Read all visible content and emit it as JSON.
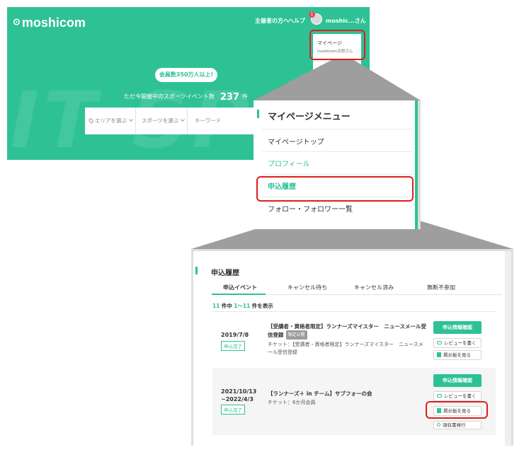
{
  "header": {
    "logo_mark": "⊙",
    "logo_text": "moshicom",
    "nav_organizer": "主催者の方へ",
    "nav_help": "ヘルプ",
    "avatar_badge": "1",
    "user_name": "moshic...さん"
  },
  "dropdown": {
    "title": "マイページ",
    "subtitle": "moshicom太郎さん"
  },
  "hero": {
    "watermark": "IT SPO",
    "members_pill": "会員数350万人以上!",
    "count_label": "ただ今開催中のスポーツイベント数",
    "count_value": "237",
    "count_unit": "件"
  },
  "search": {
    "area": "エリアを選ぶ",
    "sport": "スポーツを選ぶ",
    "keyword": "キーワード"
  },
  "menu": {
    "title": "マイページメニュー",
    "items": [
      "マイページトップ",
      "プロフィール",
      "申込履歴",
      "フォロー・フォロワー一覧"
    ]
  },
  "history": {
    "title": "申込履歴",
    "tabs": [
      "申込イベント",
      "キャンセル待ち",
      "キャンセル済み",
      "無断不参加"
    ],
    "count": {
      "total": "11",
      "mid1": "件中",
      "range": "1〜11",
      "mid2": "件を表示"
    },
    "rows": [
      {
        "date": "2019/7/8",
        "status": "申込完了",
        "title": "【受講者・資格者限定】ランナーズマイスター　ニュースメール受信登録",
        "badge": "限定公開",
        "ticket_label": "チケット：",
        "ticket": "【受講者・資格者限定】ランナーズマイスター　ニュースメール受信登録",
        "confirm": "申込情報確認",
        "review": "レビューを書く",
        "board": "掲示板を見る"
      },
      {
        "date": "2021/10/13 ~2022/4/3",
        "status": "申込完了",
        "title": "【ランナーズ＋ in チーム】サブフォーの会",
        "ticket_label": "チケット：",
        "ticket": "6か月会員",
        "confirm": "申込情報確認",
        "review": "レビューを書く",
        "board": "掲示板を見る",
        "receipt": "領収書発行"
      }
    ]
  },
  "colors": {
    "brand_green": "#2ec194",
    "highlight_red": "#e01d1d",
    "callout_gray": "#9e9e9e"
  }
}
